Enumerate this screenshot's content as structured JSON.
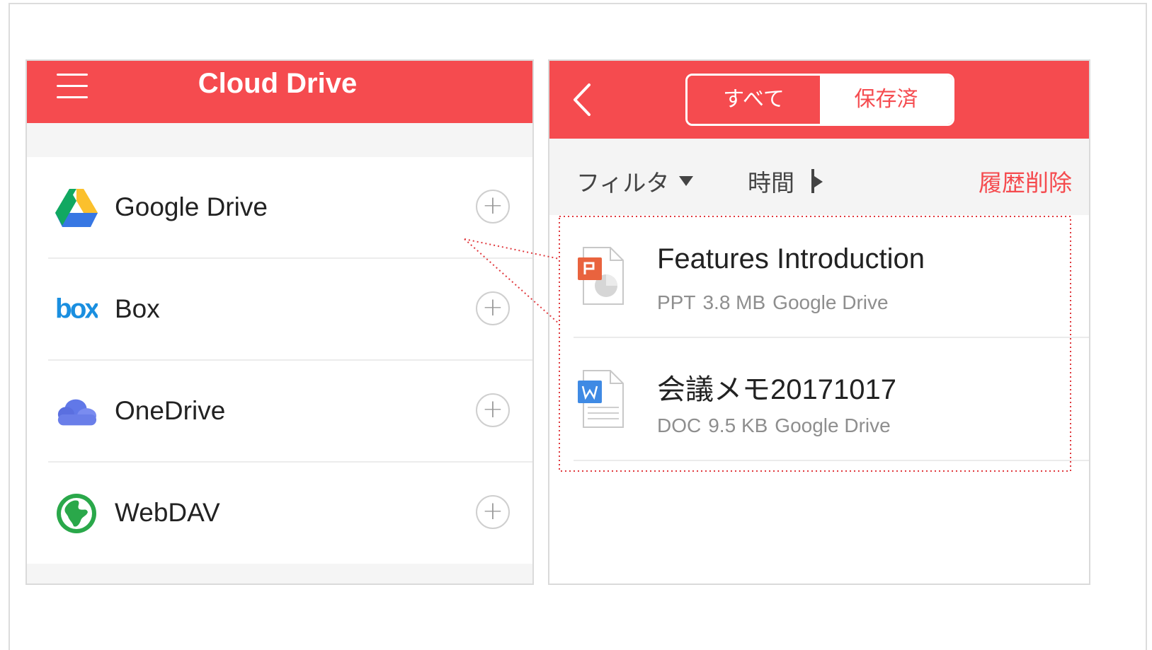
{
  "left": {
    "title": "Cloud Drive",
    "drives": [
      {
        "label": "Google Drive",
        "icon": "google-drive-icon"
      },
      {
        "label": "Box",
        "icon": "box-icon"
      },
      {
        "label": "OneDrive",
        "icon": "onedrive-icon"
      },
      {
        "label": "WebDAV",
        "icon": "webdav-globe-icon"
      }
    ],
    "add_symbol": "+"
  },
  "right": {
    "segments": {
      "all": "すべて",
      "saved": "保存済"
    },
    "filter_label": "フィルタ",
    "sort_label": "時間",
    "clear_history": "履歴削除",
    "files": [
      {
        "name": "Features Introduction",
        "type": "PPT",
        "size": "3.8 MB",
        "source": "Google Drive",
        "icon": "ppt-file-icon"
      },
      {
        "name": "会議メモ20171017",
        "type": "DOC",
        "size": "9.5 KB",
        "source": "Google Drive",
        "icon": "doc-file-icon"
      }
    ]
  },
  "colors": {
    "accent": "#f54b4f",
    "callout": "#e0393e"
  }
}
